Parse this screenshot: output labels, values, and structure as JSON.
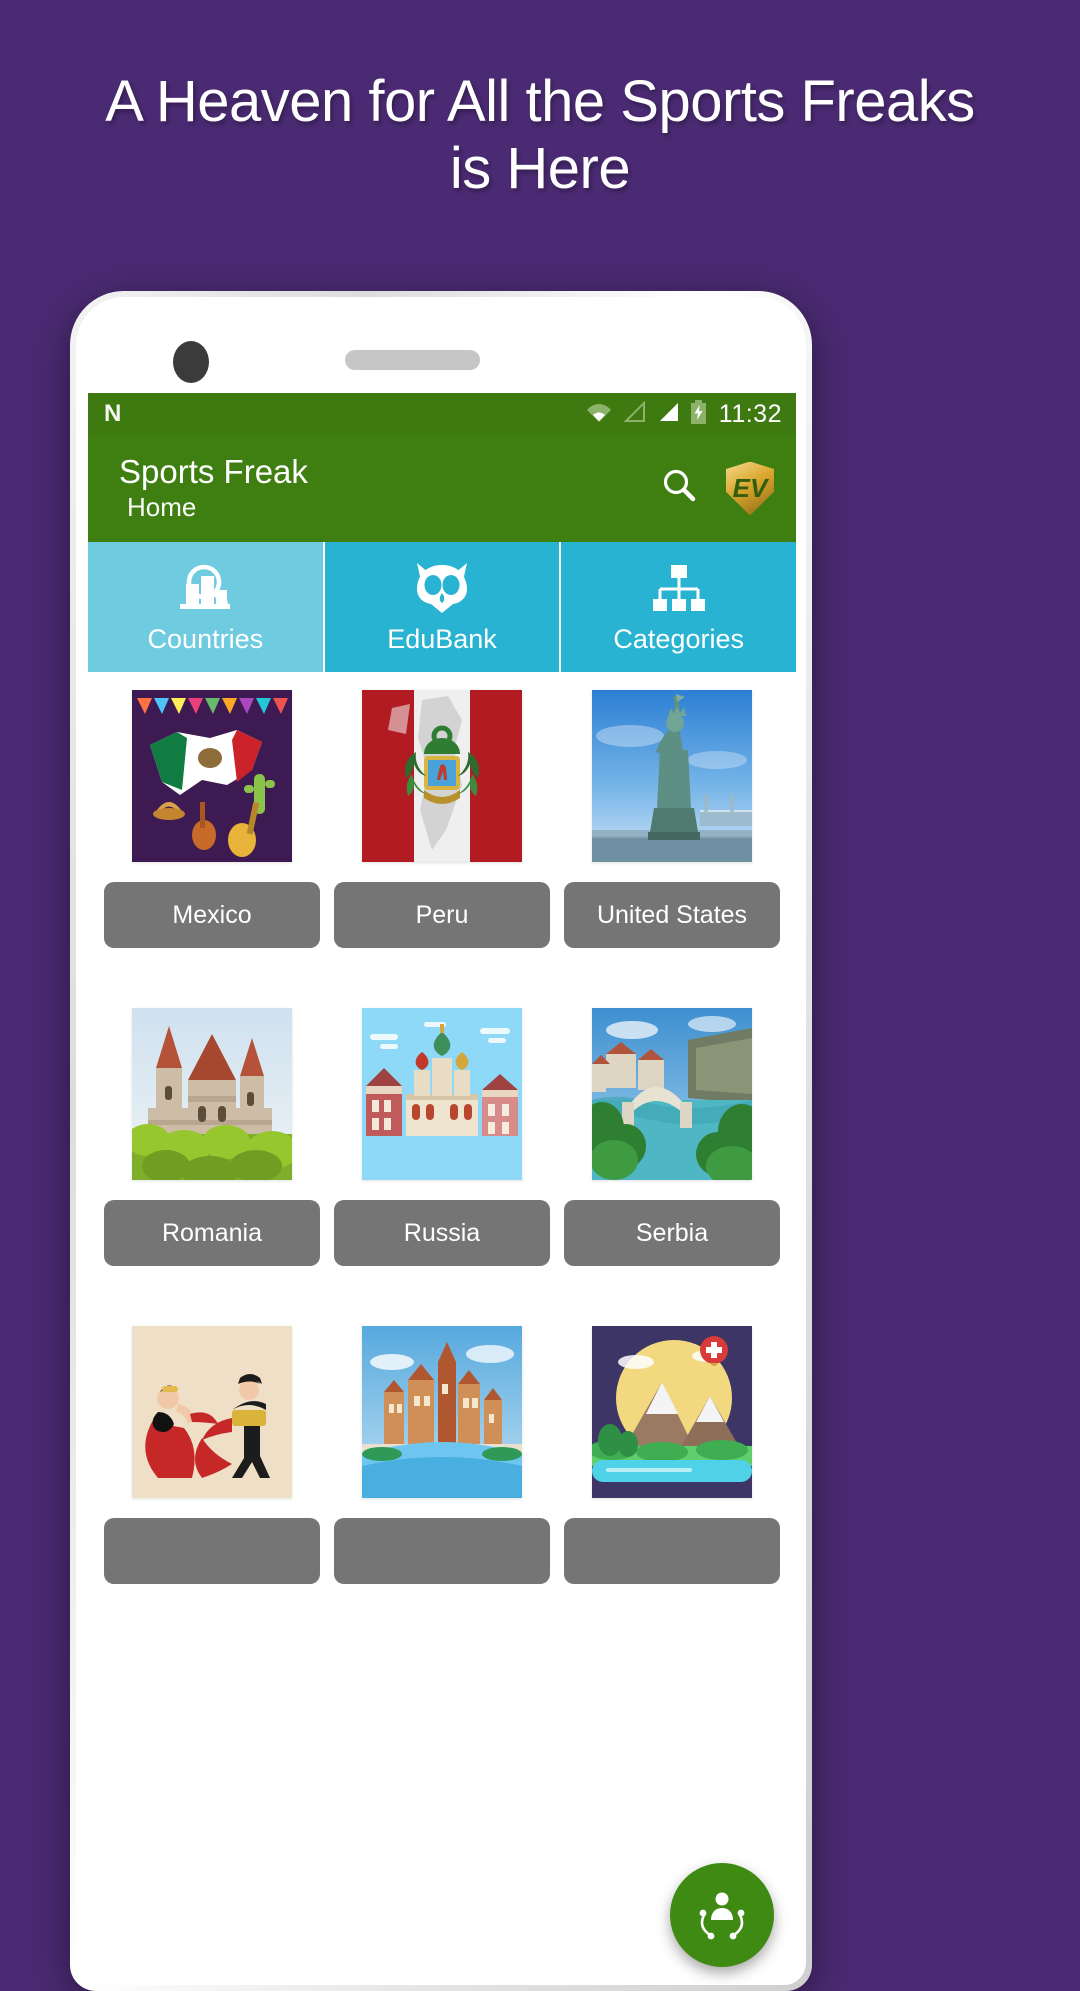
{
  "promo": {
    "headline": "A Heaven for All the Sports Freaks is Here",
    "background_color": "#4A2A72",
    "headline_color": "#FFFFFF"
  },
  "statusbar": {
    "os_logo": "android-n-logo",
    "icons": [
      "wifi-icon",
      "signal-empty-icon",
      "signal-full-icon",
      "battery-charging-icon"
    ],
    "clock": "11:32",
    "background_color": "#3F7A10"
  },
  "appbar": {
    "title": "Sports Freak",
    "subtitle": "Home",
    "background_color": "#3F7F11",
    "search_label": "search-icon",
    "badge_label": "EV"
  },
  "tabs": [
    {
      "label": "Countries",
      "icon": "city-search-icon",
      "selected": true,
      "color": "#6ECBE0"
    },
    {
      "label": "EduBank",
      "icon": "owl-icon",
      "selected": false,
      "color": "#29B3D2"
    },
    {
      "label": "Categories",
      "icon": "hierarchy-icon",
      "selected": false,
      "color": "#29B3D2"
    }
  ],
  "grid": {
    "rows": [
      [
        {
          "label": "Mexico",
          "art": "mexico"
        },
        {
          "label": "Peru",
          "art": "peru"
        },
        {
          "label": "United States",
          "art": "usa"
        }
      ],
      [
        {
          "label": "Romania",
          "art": "romania"
        },
        {
          "label": "Russia",
          "art": "russia"
        },
        {
          "label": "Serbia",
          "art": "serbia"
        }
      ],
      [
        {
          "label": "",
          "art": "spain"
        },
        {
          "label": "",
          "art": "sweden"
        },
        {
          "label": "",
          "art": "switzerland"
        }
      ]
    ]
  },
  "fab": {
    "icon": "person-network-icon",
    "color": "#3F8A12"
  }
}
